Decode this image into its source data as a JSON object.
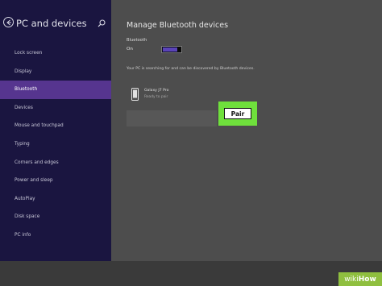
{
  "sidebar": {
    "title": "PC and devices",
    "items": [
      {
        "label": "Lock screen",
        "selected": false
      },
      {
        "label": "Display",
        "selected": false
      },
      {
        "label": "Bluetooth",
        "selected": true
      },
      {
        "label": "Devices",
        "selected": false
      },
      {
        "label": "Mouse and touchpad",
        "selected": false
      },
      {
        "label": "Typing",
        "selected": false
      },
      {
        "label": "Corners and edges",
        "selected": false
      },
      {
        "label": "Power and sleep",
        "selected": false
      },
      {
        "label": "AutoPlay",
        "selected": false
      },
      {
        "label": "Disk space",
        "selected": false
      },
      {
        "label": "PC info",
        "selected": false
      }
    ]
  },
  "main": {
    "title": "Manage Bluetooth devices",
    "bluetooth": {
      "label": "Bluetooth",
      "state": "On"
    },
    "search_status": "Your PC is searching for and can be discovered by Bluetooth devices.",
    "device": {
      "name": "Galaxy J7 Pro",
      "status": "Ready to pair"
    },
    "pair_label": "Pair"
  },
  "watermark": {
    "prefix": "wiki",
    "suffix": "How"
  },
  "colors": {
    "sidebar_bg": "#1a1540",
    "selected_item": "#56358f",
    "main_bg": "#4d4d4d",
    "toggle_fill": "#5b44b8",
    "highlight": "#6fe03c",
    "watermark_bg": "#8fbf3f"
  },
  "icons": [
    "back-arrow-icon",
    "search-icon",
    "phone-icon"
  ]
}
